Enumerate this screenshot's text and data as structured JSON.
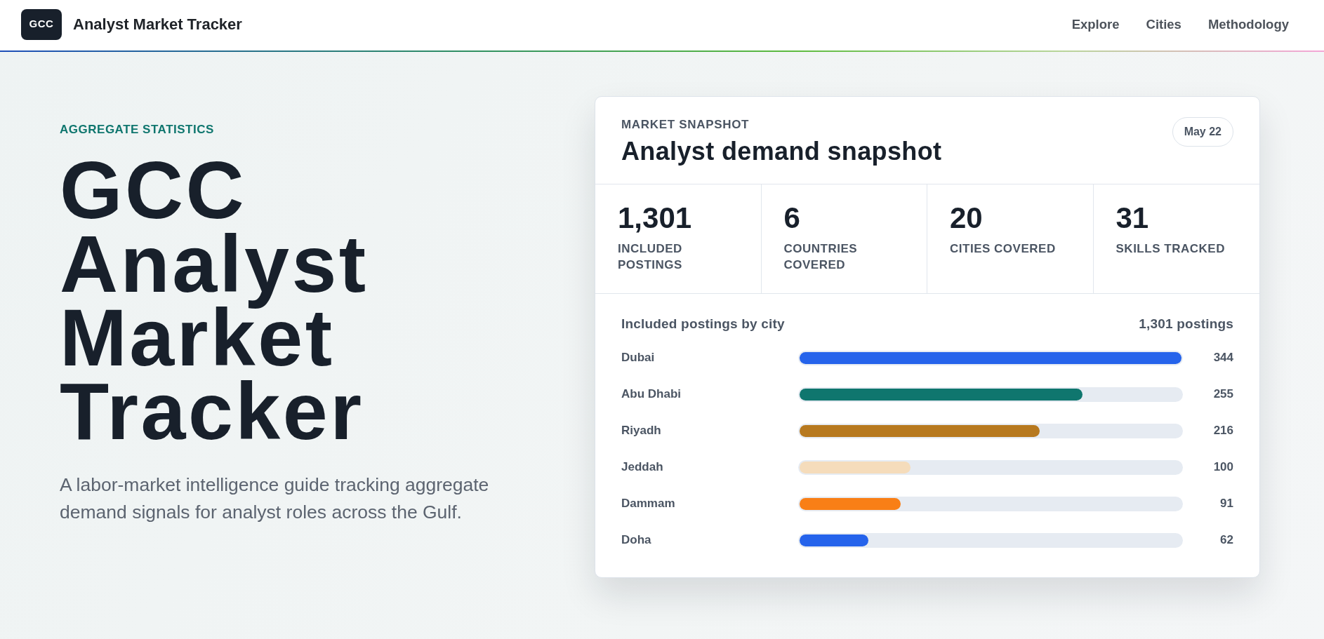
{
  "navbar": {
    "logo": "GCC",
    "brand": "Analyst Market Tracker",
    "links": [
      "Explore",
      "Cities",
      "Methodology"
    ]
  },
  "hero": {
    "eyebrow": "AGGREGATE STATISTICS",
    "title": "GCC Analyst Market Tracker",
    "description": "A labor-market intelligence guide tracking aggregate demand signals for analyst roles across the Gulf."
  },
  "snapshot_card": {
    "eyebrow": "MARKET SNAPSHOT",
    "title": "Analyst demand snapshot",
    "date": "May 22",
    "stats": [
      {
        "value": "1,301",
        "label": "INCLUDED POSTINGS"
      },
      {
        "value": "6",
        "label": "COUNTRIES COVERED"
      },
      {
        "value": "20",
        "label": "CITIES COVERED"
      },
      {
        "value": "31",
        "label": "SKILLS TRACKED"
      }
    ],
    "chart": {
      "title": "Included postings by city",
      "total": "1,301 postings",
      "rows": [
        {
          "city": "Dubai",
          "value": "344",
          "level": 1,
          "color": "#2563eb"
        },
        {
          "city": "Abu Dhabi",
          "value": "255",
          "level": 0.741,
          "color": "#0f766e"
        },
        {
          "city": "Riyadh",
          "value": "216",
          "level": 0.628,
          "color": "#b7791f"
        },
        {
          "city": "Jeddah",
          "value": "100",
          "level": 0.291,
          "color": "#f5dcbb"
        },
        {
          "city": "Dammam",
          "value": "91",
          "level": 0.265,
          "color": "#f97f16"
        },
        {
          "city": "Doha",
          "value": "62",
          "level": 0.18,
          "color": "#2563eb"
        }
      ]
    }
  }
}
